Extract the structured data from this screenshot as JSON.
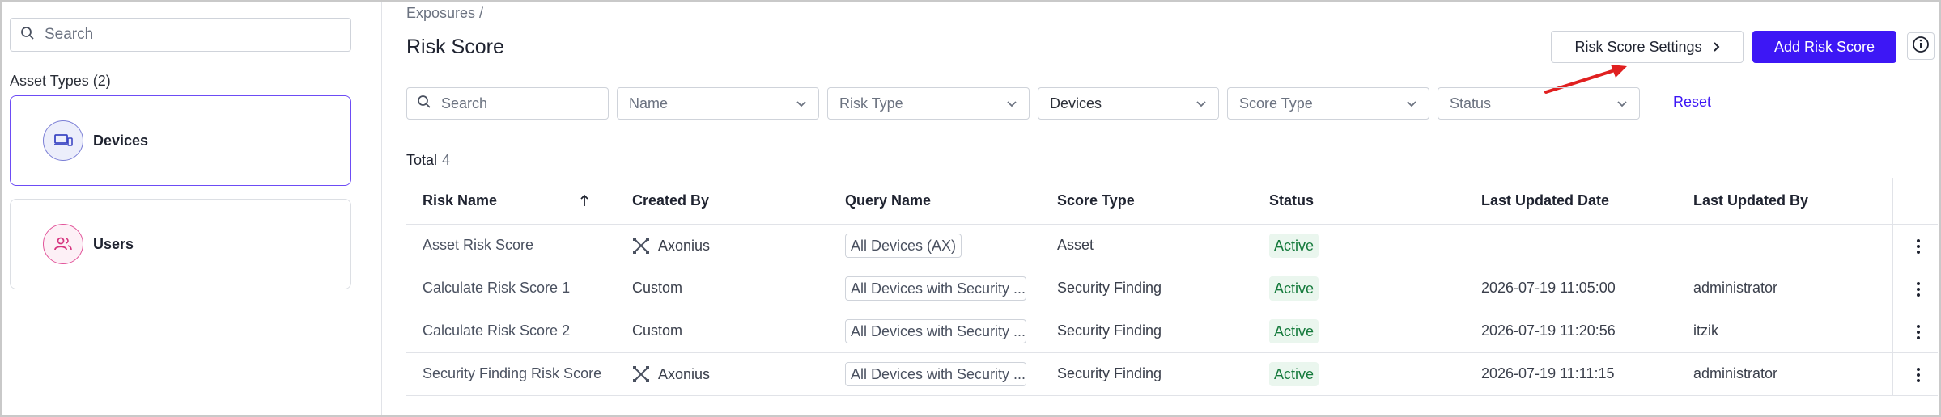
{
  "sidebar": {
    "search_placeholder": "Search",
    "asset_types_title": "Asset Types (2)",
    "items": [
      {
        "label": "Devices",
        "icon": "devices-icon",
        "selected": true
      },
      {
        "label": "Users",
        "icon": "users-icon",
        "selected": false
      }
    ]
  },
  "header": {
    "breadcrumb": "Exposures /",
    "title": "Risk Score",
    "settings_label": "Risk Score Settings",
    "add_label": "Add Risk Score"
  },
  "filters": {
    "search_placeholder": "Search",
    "name": "Name",
    "risk_type": "Risk Type",
    "devices": "Devices",
    "score_type": "Score Type",
    "status": "Status",
    "reset": "Reset"
  },
  "total": {
    "label": "Total",
    "count": "4"
  },
  "table": {
    "columns": [
      "Risk Name",
      "Created By",
      "Query Name",
      "Score Type",
      "Status",
      "Last Updated Date",
      "Last Updated By"
    ],
    "rows": [
      {
        "name": "Asset Risk Score",
        "created_by": "Axonius",
        "query": "All Devices (AX)",
        "score_type": "Asset",
        "status": "Active",
        "updated_date": "",
        "updated_by": ""
      },
      {
        "name": "Calculate Risk Score 1",
        "created_by": "Custom",
        "query": "All Devices with Security ...",
        "score_type": "Security Finding",
        "status": "Active",
        "updated_date": "2026-07-19 11:05:00",
        "updated_by": "administrator"
      },
      {
        "name": "Calculate Risk Score 2",
        "created_by": "Custom",
        "query": "All Devices with Security ...",
        "score_type": "Security Finding",
        "status": "Active",
        "updated_date": "2026-07-19 11:20:56",
        "updated_by": "itzik"
      },
      {
        "name": "Security Finding Risk Score",
        "created_by": "Axonius",
        "query": "All Devices with Security ...",
        "score_type": "Security Finding",
        "status": "Active",
        "updated_date": "2026-07-19 11:11:15",
        "updated_by": "administrator"
      }
    ]
  },
  "colors": {
    "accent": "#3d17f5",
    "active_bg": "#eaf6ee",
    "active_text": "#157a3c",
    "annotation_arrow": "#e02020"
  }
}
